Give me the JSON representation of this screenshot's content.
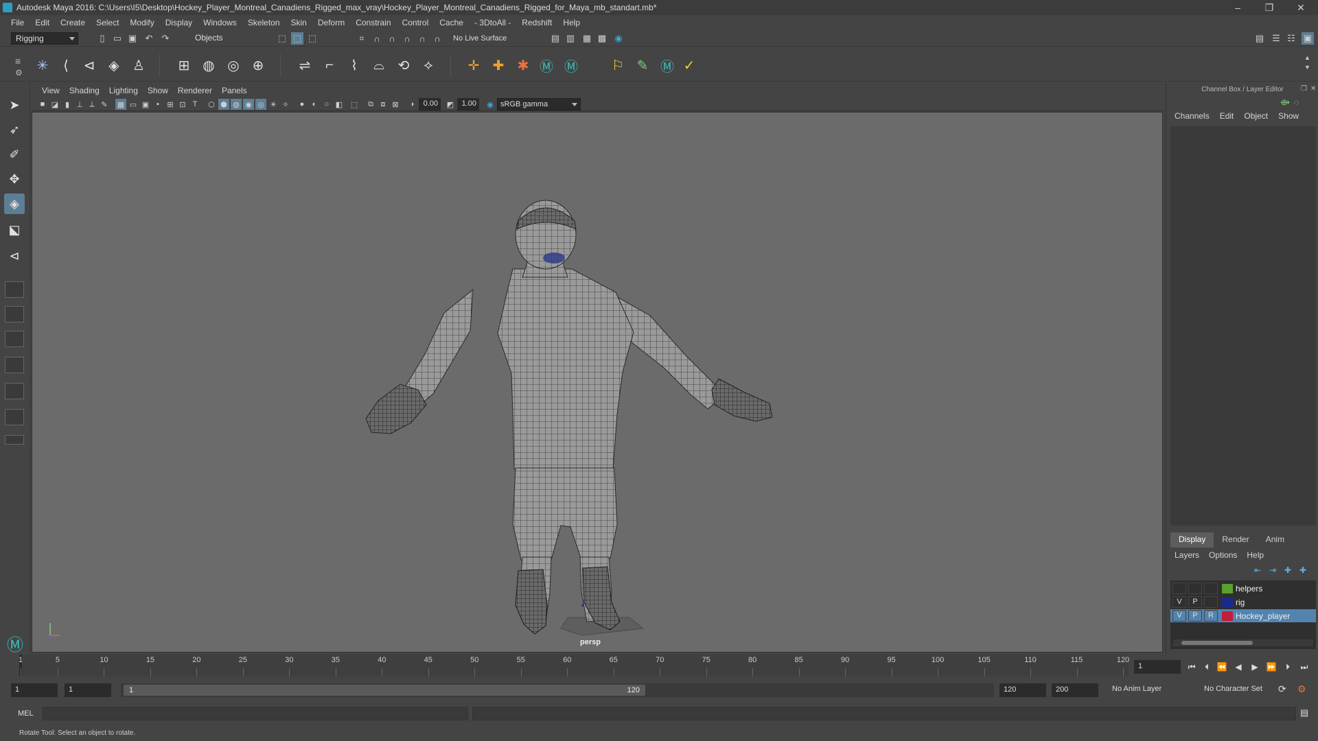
{
  "window": {
    "title": "Autodesk Maya 2016: C:\\Users\\I5\\Desktop\\Hockey_Player_Montreal_Canadiens_Rigged_max_vray\\Hockey_Player_Montreal_Canadiens_Rigged_for_Maya_mb_standart.mb*",
    "minimize": "–",
    "maximize": "❐",
    "close": "✕"
  },
  "menubar": [
    "File",
    "Edit",
    "Create",
    "Select",
    "Modify",
    "Display",
    "Windows",
    "Skeleton",
    "Skin",
    "Deform",
    "Constrain",
    "Control",
    "Cache",
    "- 3DtoAll -",
    "Redshift",
    "Help"
  ],
  "statusline": {
    "menuset": "Rigging",
    "selection_mode": "Objects",
    "live_surface": "No Live Surface"
  },
  "viewport": {
    "menus": [
      "View",
      "Shading",
      "Lighting",
      "Show",
      "Renderer",
      "Panels"
    ],
    "exposure": "0.00",
    "gamma": "1.00",
    "color_space": "sRGB gamma",
    "camera": "persp"
  },
  "channelbox": {
    "header": "Channel Box / Layer Editor",
    "menus": [
      "Channels",
      "Edit",
      "Object",
      "Show"
    ],
    "layer_tabs": [
      "Display",
      "Render",
      "Anim"
    ],
    "active_tab": "Display",
    "layer_menus": [
      "Layers",
      "Options",
      "Help"
    ],
    "layers": [
      {
        "v": "",
        "p": "",
        "r": "",
        "name": "helpers",
        "color": "#5aa02c",
        "selected": false
      },
      {
        "v": "V",
        "p": "P",
        "r": "",
        "name": "rig",
        "color": "#1a2a8c",
        "selected": false
      },
      {
        "v": "V",
        "p": "P",
        "r": "R",
        "name": "Hockey_player",
        "color": "#c0203a",
        "selected": true
      }
    ]
  },
  "timeslider": {
    "ticks": [
      "1",
      "5",
      "10",
      "15",
      "20",
      "25",
      "30",
      "35",
      "40",
      "45",
      "50",
      "55",
      "60",
      "65",
      "70",
      "75",
      "80",
      "85",
      "90",
      "95",
      "100",
      "105",
      "110",
      "115",
      "120"
    ],
    "current_frame": "1"
  },
  "rangeslider": {
    "start": "1",
    "playback_start": "1",
    "range_start_label": "1",
    "range_end_label": "120",
    "playback_end": "120",
    "end": "200",
    "anim_layer": "No Anim Layer",
    "character_set": "No Character Set"
  },
  "cmdline": {
    "label": "MEL"
  },
  "helpline": {
    "text": "Rotate Tool: Select an object to rotate."
  },
  "colors": {
    "accent_blue": "#5384b0",
    "viewport_bg": "#6b6b6b",
    "panel_bg": "#444444"
  }
}
